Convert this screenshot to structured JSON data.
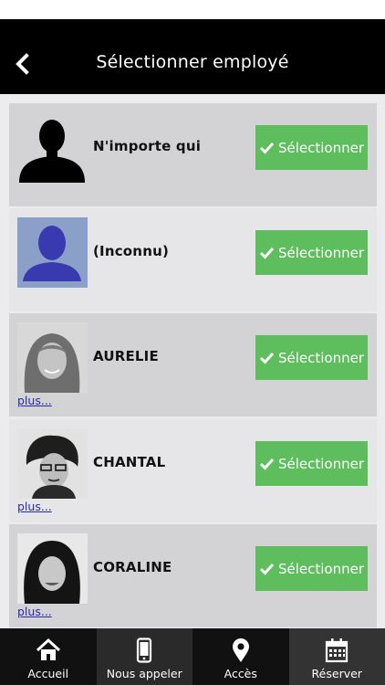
{
  "header": {
    "title": "Sélectionner employé",
    "back_icon": "chevron-left-icon"
  },
  "employees": [
    {
      "name": "N'importe qui",
      "button_label": "Sélectionner",
      "button_icon": "check-icon",
      "more": "",
      "avatar": "silhouette-black"
    },
    {
      "name": "(Inconnu)",
      "button_label": "Sélectionner",
      "button_icon": "check-icon",
      "more": "",
      "avatar": "silhouette-blue"
    },
    {
      "name": "AURELIE",
      "button_label": "Sélectionner",
      "button_icon": "check-icon",
      "more": "plus...",
      "avatar": "photo-aurelie"
    },
    {
      "name": "CHANTAL",
      "button_label": "Sélectionner",
      "button_icon": "check-icon",
      "more": "plus...",
      "avatar": "photo-chantal"
    },
    {
      "name": "CORALINE",
      "button_label": "Sélectionner",
      "button_icon": "check-icon",
      "more": "plus...",
      "avatar": "photo-coraline"
    }
  ],
  "tabbar": [
    {
      "label": "Accueil",
      "icon": "home-icon",
      "bg": "#111111"
    },
    {
      "label": "Nous appeler",
      "icon": "phone-icon",
      "bg": "#2a2a2a"
    },
    {
      "label": "Accès",
      "icon": "map-pin-icon",
      "bg": "#111111"
    },
    {
      "label": "Réserver",
      "icon": "calendar-icon",
      "bg": "#333333"
    }
  ],
  "colors": {
    "header_bg": "#000000",
    "select_green": "#5ebe5e",
    "link_blue": "#2a2aa8"
  }
}
